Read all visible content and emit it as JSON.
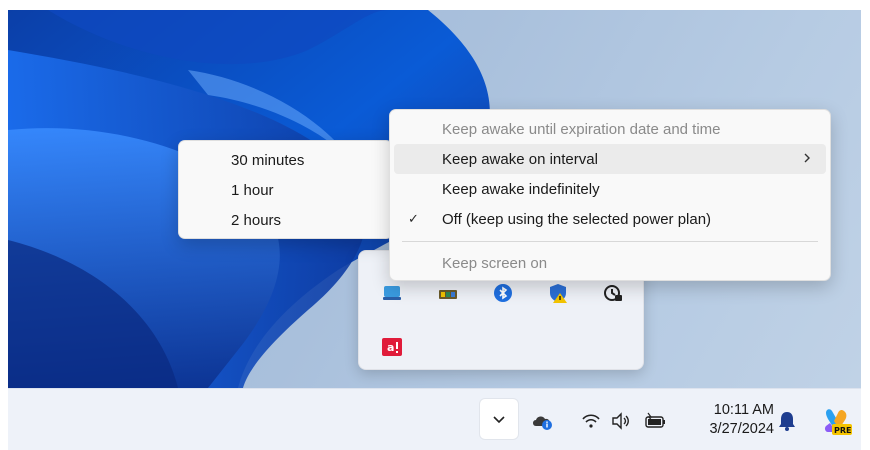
{
  "main_menu": {
    "items": [
      {
        "label": "Keep awake until expiration date and time",
        "state": "disabled"
      },
      {
        "label": "Keep awake on interval",
        "state": "hover",
        "has_submenu": true
      },
      {
        "label": "Keep awake indefinitely",
        "state": "normal"
      },
      {
        "label": "Off (keep using the selected power plan)",
        "state": "checked",
        "check_glyph": "✓"
      },
      {
        "label": "Keep screen on",
        "state": "disabled"
      }
    ]
  },
  "sub_menu": {
    "items": [
      {
        "label": "30 minutes"
      },
      {
        "label": "1 hour"
      },
      {
        "label": "2 hours"
      }
    ]
  },
  "tray_flyout": {
    "icons": [
      "weather-icon",
      "battery-status-icon",
      "bluetooth-icon",
      "shield-warning-icon",
      "awake-coffee-icon",
      "adobe-alert-icon"
    ]
  },
  "taskbar": {
    "overflow_icon": "chevron-up-icon",
    "system_icons": [
      "onedrive-info-icon",
      "wifi-icon",
      "volume-icon",
      "battery-icon"
    ],
    "clock": {
      "time": "10:11 AM",
      "date": "3/27/2024"
    },
    "notification_icon": "bell-icon",
    "copilot_icon": "copilot-icon",
    "copilot_badge": "PRE"
  },
  "colors": {
    "accent_blue": "#0a5bd6",
    "menu_bg": "#f9f9f9",
    "taskbar_bg": "#eef2f9"
  }
}
